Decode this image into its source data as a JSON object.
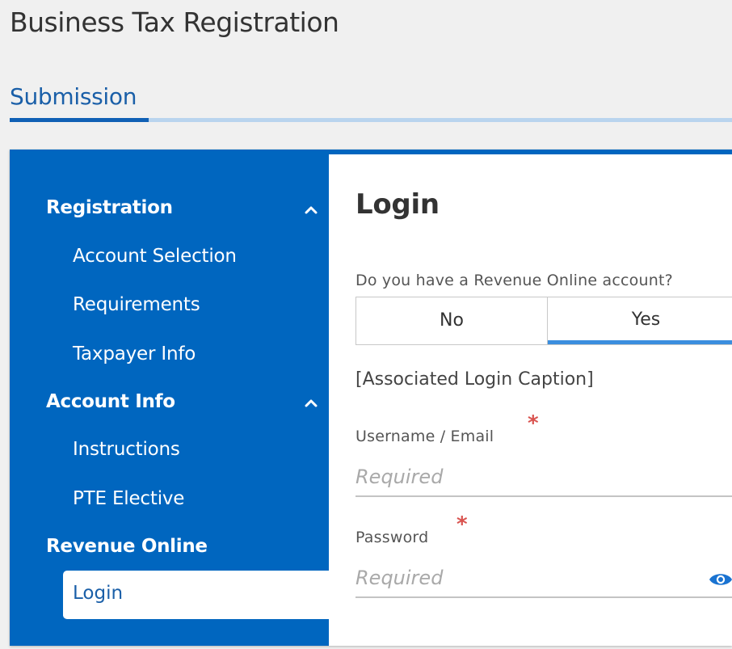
{
  "header": {
    "title": "Business Tax Registration",
    "subtitle": "Submission"
  },
  "sidebar": {
    "sections": [
      {
        "label": "Registration",
        "items": [
          "Account Selection",
          "Requirements",
          "Taxpayer Info"
        ]
      },
      {
        "label": "Account Info",
        "items": [
          "Instructions",
          "PTE Elective"
        ]
      },
      {
        "label": "Revenue Online",
        "items": [
          "Login"
        ]
      }
    ],
    "active_item": "Login"
  },
  "main": {
    "title": "Login",
    "question": "Do you have a Revenue Online account?",
    "toggle": {
      "no_label": "No",
      "yes_label": "Yes",
      "selected": "Yes"
    },
    "caption": "[Associated Login Caption]",
    "fields": {
      "username": {
        "label": "Username / Email",
        "placeholder": "Required",
        "required_mark": "*"
      },
      "password": {
        "label": "Password",
        "placeholder": "Required",
        "required_mark": "*"
      }
    }
  },
  "icons": {
    "section_chevron": "chevron-up-icon",
    "password_reveal": "eye-icon"
  },
  "colors": {
    "primary_blue": "#0066bf",
    "title_blue": "#1a5fa8",
    "tab_underline_light": "#b9d4ee",
    "toggle_selected_underline": "#3b8ede",
    "required_red": "#d9534f"
  }
}
